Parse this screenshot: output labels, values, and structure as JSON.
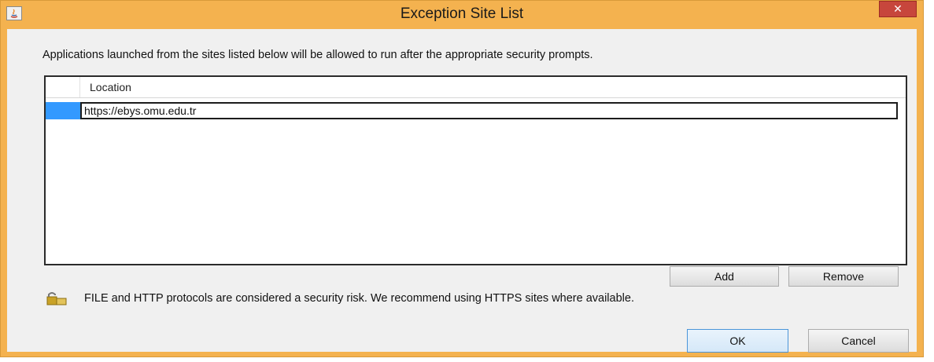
{
  "window": {
    "title": "Exception Site List",
    "close_label": "✕",
    "accent_color": "#f4b24f"
  },
  "description": "Applications launched from the sites listed below will be allowed to run after the appropriate security prompts.",
  "table": {
    "column_header": "Location",
    "rows": [
      {
        "location": "https://ebys.omu.edu.tr",
        "selected": true,
        "editing": true
      }
    ],
    "selection_color": "#3399ff"
  },
  "buttons": {
    "add": "Add",
    "remove": "Remove",
    "ok": "OK",
    "cancel": "Cancel"
  },
  "warning": {
    "icon": "lock-icon",
    "text": "FILE and HTTP protocols are considered a security risk.  We recommend using HTTPS sites where available."
  }
}
